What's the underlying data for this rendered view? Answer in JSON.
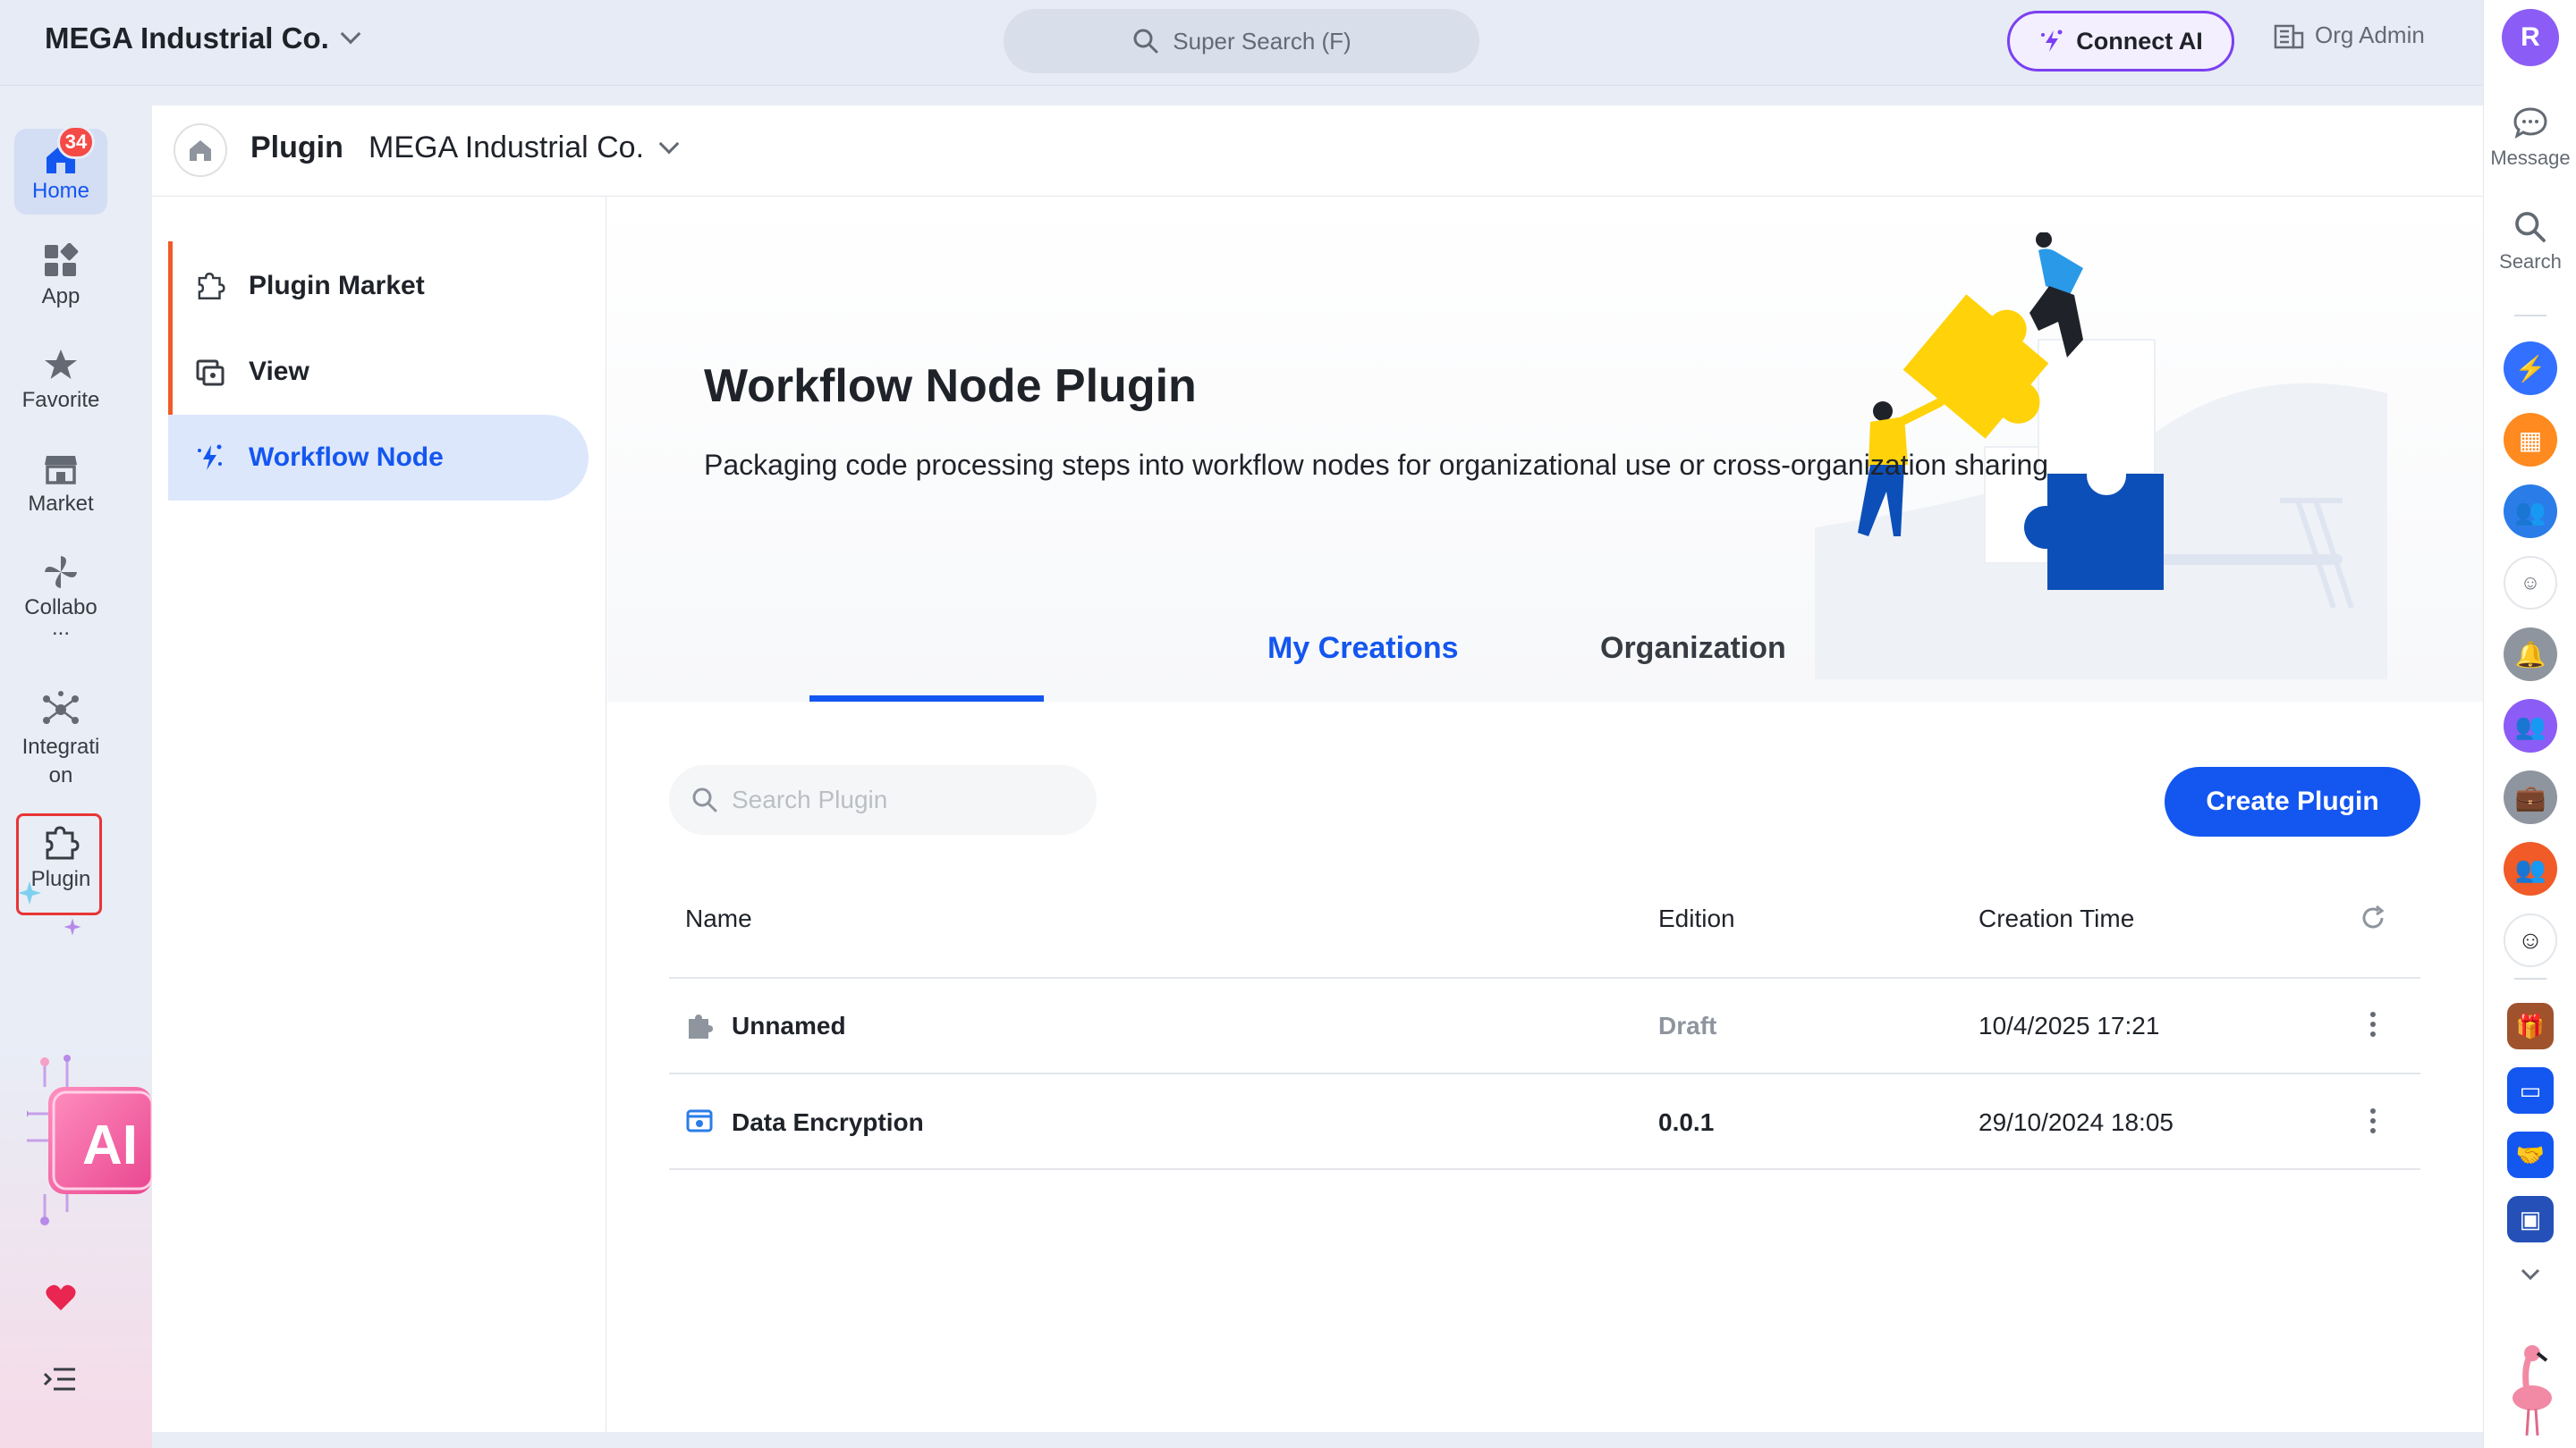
{
  "topbar": {
    "org_name": "MEGA Industrial Co.",
    "super_search": "Super Search (F)",
    "connect_ai": "Connect AI",
    "org_admin": "Org Admin"
  },
  "right_rail": {
    "avatar_initial": "R",
    "message_label": "Message",
    "search_label": "Search"
  },
  "left_rail": {
    "home_label": "Home",
    "home_badge": "34",
    "app_label": "App",
    "favorite_label": "Favorite",
    "market_label": "Market",
    "collabo_label_1": "Collabo",
    "collabo_label_2": "...",
    "integration_label_1": "Integrati",
    "integration_label_2": "on",
    "plugin_label": "Plugin",
    "ai_text": "AI"
  },
  "breadcrumb": {
    "title": "Plugin",
    "org": "MEGA Industrial Co."
  },
  "sub_nav": {
    "items": [
      {
        "label": "Plugin Market",
        "icon": "plugin-icon"
      },
      {
        "label": "View",
        "icon": "view-icon"
      },
      {
        "label": "Workflow Node",
        "icon": "workflow-icon",
        "active": true
      }
    ]
  },
  "hero": {
    "title": "Workflow Node Plugin",
    "description": "Packaging code processing steps into workflow nodes for organizational use or cross-organization sharing",
    "tabs": [
      {
        "label": "My Creations",
        "active": true
      },
      {
        "label": "Organization",
        "active": false
      }
    ]
  },
  "toolbar": {
    "search_placeholder": "Search Plugin",
    "create_label": "Create Plugin"
  },
  "table": {
    "columns": [
      "Name",
      "Edition",
      "Creation Time"
    ],
    "rows": [
      {
        "name": "Unnamed",
        "edition": "Draft",
        "created": "10/4/2025 17:21"
      },
      {
        "name": "Data Encryption",
        "edition": "0.0.1",
        "created": "29/10/2024 18:05"
      }
    ]
  },
  "colors": {
    "accent": "#1456f0",
    "active_bar": "#f05b28",
    "badge": "#f54a45",
    "connect_ai_border": "#7b3ff2"
  }
}
